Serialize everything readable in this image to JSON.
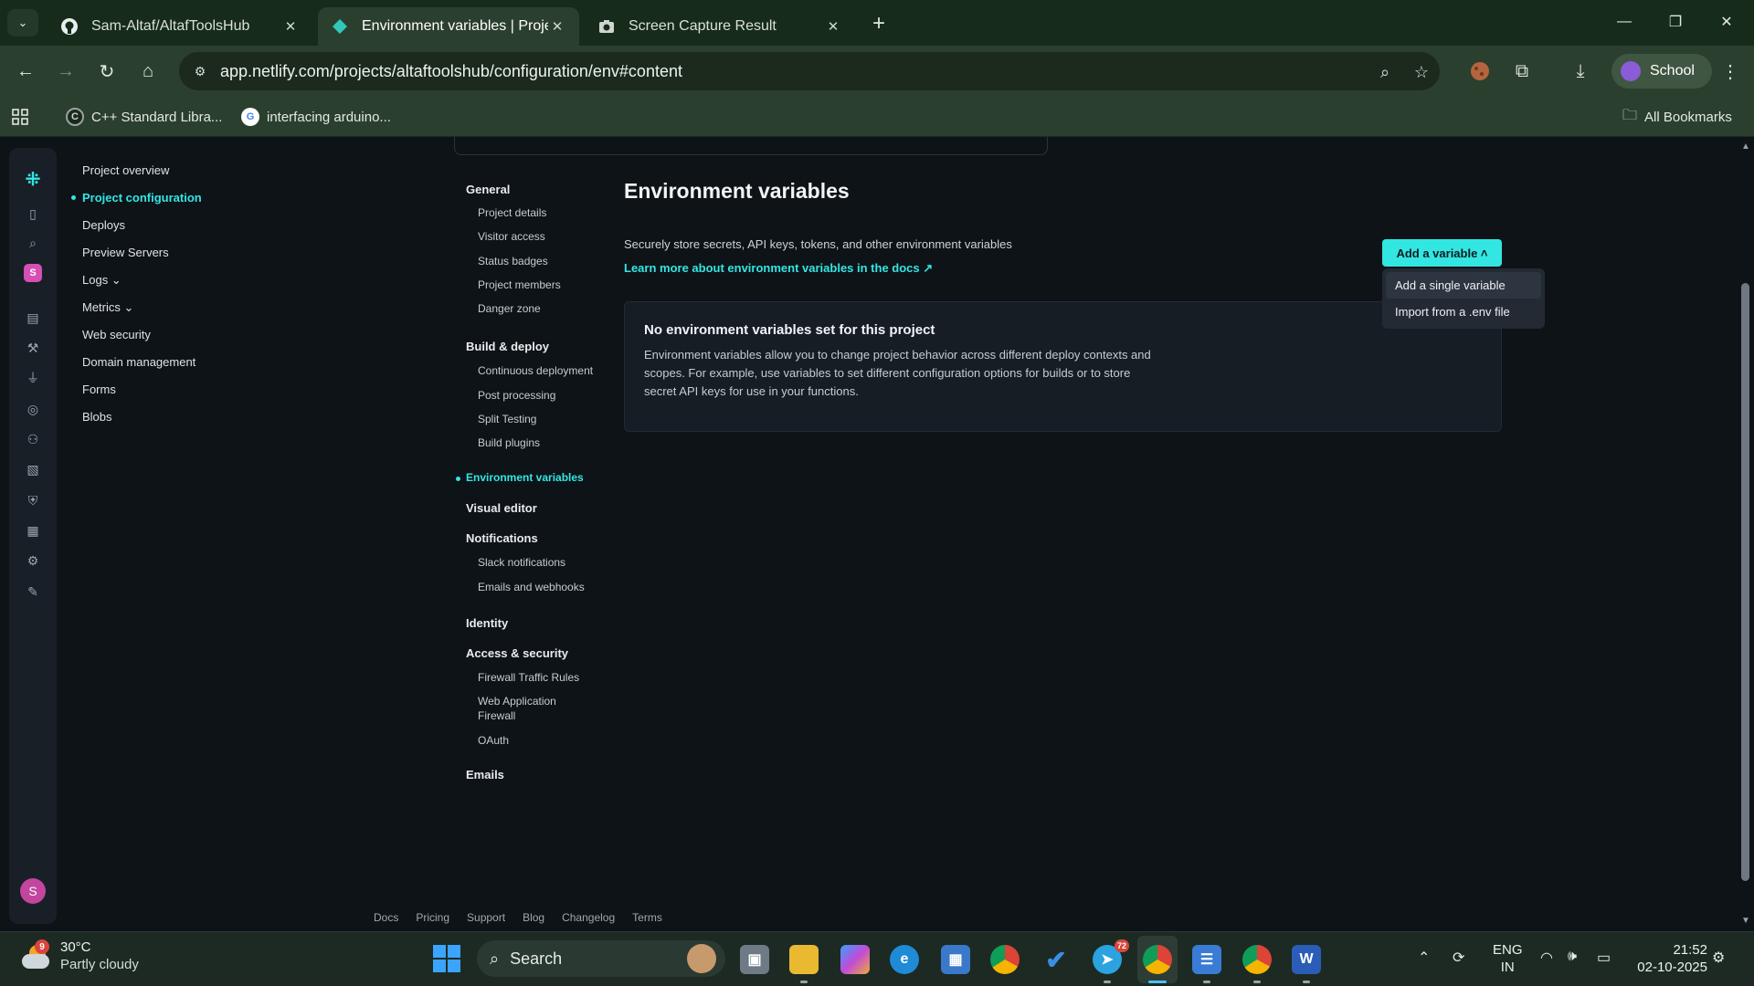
{
  "browser": {
    "tabs": [
      {
        "title": "Sam-Altaf/AltafToolsHub",
        "active": false
      },
      {
        "title": "Environment variables | Project",
        "active": true
      },
      {
        "title": "Screen Capture Result",
        "active": false
      }
    ],
    "url": "app.netlify.com/projects/altaftoolshub/configuration/env#content",
    "profile": "School",
    "bookmarks": [
      "C++ Standard Libra...",
      "interfacing arduino..."
    ],
    "all_bookmarks": "All Bookmarks"
  },
  "mainnav": {
    "items": [
      {
        "label": "Project overview",
        "active": false
      },
      {
        "label": "Project configuration",
        "active": true
      },
      {
        "label": "Deploys",
        "active": false
      },
      {
        "label": "Preview Servers",
        "active": false
      },
      {
        "label": "Logs ⌄",
        "active": false
      },
      {
        "label": "Metrics ⌄",
        "active": false
      },
      {
        "label": "Web security",
        "active": false
      },
      {
        "label": "Domain management",
        "active": false
      },
      {
        "label": "Forms",
        "active": false
      },
      {
        "label": "Blobs",
        "active": false
      }
    ]
  },
  "subnav": {
    "general": "General",
    "general_items": [
      "Project details",
      "Visitor access",
      "Status badges",
      "Project members",
      "Danger zone"
    ],
    "build": "Build & deploy",
    "build_items": [
      "Continuous deployment",
      "Post processing",
      "Split Testing",
      "Build plugins"
    ],
    "env": "Environment variables",
    "visual": "Visual editor",
    "notifications": "Notifications",
    "notification_items": [
      "Slack notifications",
      "Emails and webhooks"
    ],
    "identity": "Identity",
    "access": "Access & security",
    "access_items": [
      "Firewall Traffic Rules",
      "Web Application Firewall",
      "OAuth"
    ],
    "emails": "Emails"
  },
  "content": {
    "title": "Environment variables",
    "description": "Securely store secrets, API keys, tokens, and other environment variables",
    "docs_link": "Learn more about environment variables in the docs ↗",
    "empty_title": "No environment variables set for this project",
    "empty_text": "Environment variables allow you to change project behavior across different deploy contexts and scopes. For example, use variables to set different configuration options for builds or to store secret API keys for use in your functions.",
    "add_button": "Add a variable ˄",
    "dropdown": [
      "Add a single variable",
      "Import from a .env file"
    ]
  },
  "footer": [
    "Docs",
    "Pricing",
    "Support",
    "Blog",
    "Changelog",
    "Terms"
  ],
  "taskbar": {
    "weather_temp": "30°C",
    "weather_text": "Partly cloudy",
    "weather_badge": "9",
    "search": "Search",
    "telegram_count": "72",
    "lang_1": "ENG",
    "lang_2": "IN",
    "time": "21:52",
    "date": "02-10-2025"
  },
  "colors": {
    "accent": "#32e6e2",
    "background": "#0e1318"
  }
}
